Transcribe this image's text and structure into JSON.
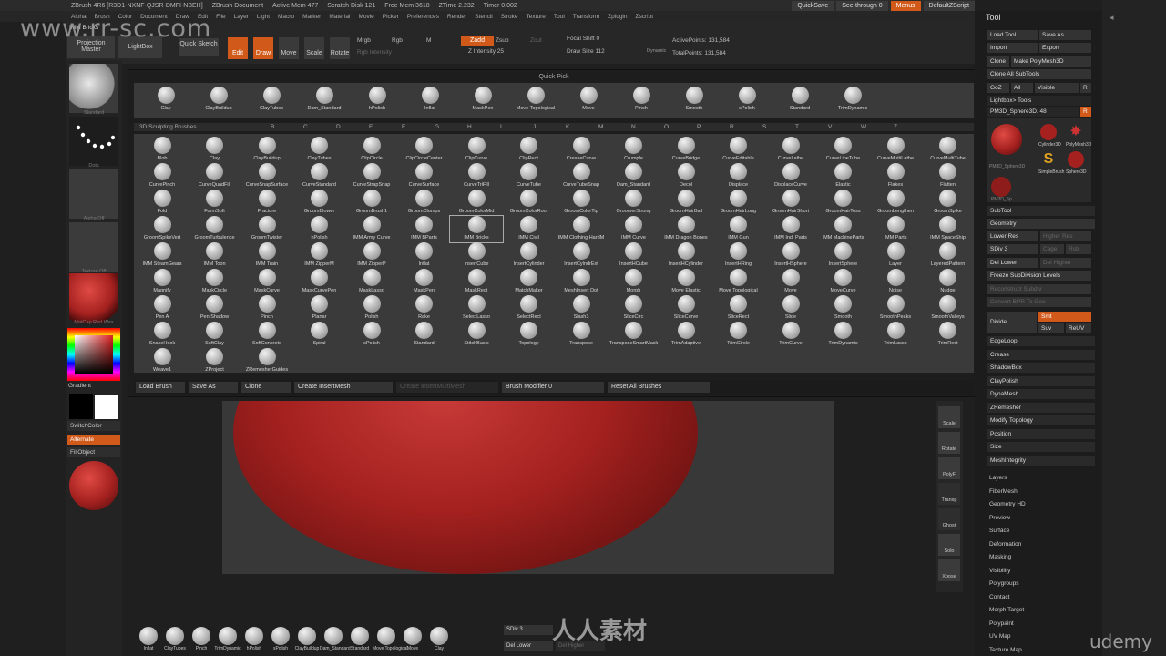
{
  "window": {
    "title": "ZBrush 4R6 [R3D1-NXNF-QJSR-DMFI-NBEH]",
    "document": "ZBrush Document",
    "active_mem": "Active Mem 477",
    "scratch_disk": "Scratch Disk 121",
    "free_mem": "Free Mem 3618",
    "ztime": "ZTime 2.232",
    "timer": "Timer 0.002",
    "quicksave": "QuickSave",
    "see_through": "See-through 0",
    "menus": "Menus",
    "default_zscript": "DefaultZScript"
  },
  "menu": [
    "Alpha",
    "Brush",
    "Color",
    "Document",
    "Draw",
    "Edit",
    "File",
    "Layer",
    "Light",
    "Macro",
    "Marker",
    "Material",
    "Movie",
    "Picker",
    "Preferences",
    "Render",
    "Stencil",
    "Stroke",
    "Texture",
    "Tool",
    "Transform",
    "Zplugin",
    "Zscript"
  ],
  "watermark_url": "www.rr-sc.com",
  "toolbar": {
    "imm_brush": "IMM Bricks",
    "projection_master": "Projection Master",
    "lightbox": "LightBox",
    "quick_sketch": "Quick Sketch",
    "edit": "Edit",
    "draw": "Draw",
    "move": "Move",
    "scale": "Scale",
    "rotate": "Rotate",
    "mrgb": "Mrgb",
    "rgb": "Rgb",
    "m": "M",
    "rgb_intensity": "Rgb Intensity",
    "zadd": "Zadd",
    "zsub": "Zsub",
    "zcut": "Zcut",
    "z_intensity": "Z Intensity 25",
    "focal_shift": "Focal Shift 0",
    "draw_size": "Draw Size 112",
    "dynamic": "Dynamic",
    "active_points": "ActivePoints: 131,584",
    "total_points": "TotalPoints: 131,584"
  },
  "popup": {
    "quick_pick_title": "Quick Pick",
    "section_title": "3D Sculpting Brushes",
    "letters": [
      "B",
      "C",
      "D",
      "E",
      "F",
      "G",
      "H",
      "I",
      "J",
      "K",
      "M",
      "N",
      "O",
      "P",
      "R",
      "S",
      "T",
      "V",
      "W",
      "Z"
    ],
    "quick_pick": [
      "Clay",
      "ClayBuildup",
      "ClayTubes",
      "Dam_Standard",
      "hPolish",
      "Inflat",
      "MaskPen",
      "Move Topological",
      "Move",
      "Pinch",
      "Smooth",
      "sPolish",
      "Standard",
      "TrimDynamic"
    ],
    "brushes": [
      "Blob",
      "Clay",
      "ClayBuildup",
      "ClayTubes",
      "ClipCircle",
      "ClipCircleCenter",
      "ClipCurve",
      "ClipRect",
      "CreaseCurve",
      "Crumple",
      "CurveBridge",
      "CurveEditable",
      "CurveLathe",
      "CurveLineTube",
      "CurveMultiLathe",
      "CurveMultiTube",
      "CurvePinch",
      "CurveQuadFill",
      "CurveSnapSurface",
      "CurveStandard",
      "CurveStrapSnap",
      "CurveSurface",
      "CurveTriFill",
      "CurveTube",
      "CurveTubeSnap",
      "Dam_Standard",
      "Decol",
      "Displace",
      "DisplaceCurve",
      "Elastic",
      "Flakes",
      "Flatten",
      "Fold",
      "FormSoft",
      "Fracture",
      "GroomBlower",
      "GroomBrush1",
      "GroomClumps",
      "GroomColorMid",
      "GroomColorRoot",
      "GroomColorTip",
      "GroomerStrong",
      "GroomHairBall",
      "GroomHairLong",
      "GroomHairShort",
      "GroomHairToss",
      "GroomLengthen",
      "GroomSpike",
      "GroomSpikeVert",
      "GroomTurbulence",
      "GroomTwister",
      "hPolish",
      "IMM Army Curve",
      "IMM BParts",
      "IMM Bricks",
      "IMM Civil",
      "IMM Clothing HardM",
      "IMM Curve",
      "IMM Dragon Bones",
      "IMM Gun",
      "IMM Ind. Parts",
      "IMM MachineParts",
      "IMM Parts",
      "IMM SpaceShip",
      "IMM SteamGears",
      "IMM Toon",
      "IMM Train",
      "IMM ZipperM",
      "IMM ZipperP",
      "Inflat",
      "InsertCube",
      "InsertCylinder",
      "InsertCylndrExt",
      "InsertHCube",
      "InsertHCylinder",
      "InsertHRing",
      "InsertHSphere",
      "InsertSphere",
      "Layer",
      "LayeredPattern",
      "Magnify",
      "MaskCircle",
      "MaskCurve",
      "MaskCurvePen",
      "MaskLasso",
      "MaskPen",
      "MaskRect",
      "MatchMaker",
      "MeshInsert Dot",
      "Morph",
      "Move Elastic",
      "Move Topological",
      "Move",
      "MoveCurve",
      "Noise",
      "Nudge",
      "Pen A",
      "Pen Shadow",
      "Pinch",
      "Planar",
      "Polish",
      "Rake",
      "SelectLasso",
      "SelectRect",
      "Slash3",
      "SliceCirc",
      "SliceCurve",
      "SliceRect",
      "Slide",
      "Smooth",
      "SmoothPeaks",
      "SmoothValleys",
      "SnakeHook",
      "SoftClay",
      "SoftConcrete",
      "Spiral",
      "sPolish",
      "Standard",
      "StitchBasic",
      "Topology",
      "Transpose",
      "TransposeSmartMask",
      "TrimAdaptive",
      "TrimCircle",
      "TrimCurve",
      "TrimDynamic",
      "TrimLasso",
      "TrimRect",
      "Weave1",
      "ZProject",
      "ZRemesherGuides"
    ],
    "footer": {
      "load_brush": "Load Brush",
      "save_as": "Save As",
      "clone": "Clone",
      "create_insertmesh": "Create InsertMesh",
      "create_insertmultimesh": "Create InsertMultiMesh",
      "brush_modifier": "Brush Modifier 0",
      "reset_all_brushes": "Reset All Brushes"
    }
  },
  "left_shelf": {
    "standard": "Standard",
    "dots": "Dots",
    "alpha_off": "Alpha Off",
    "texture_off": "Texture Off",
    "matcap": "MatCap Red Wax",
    "gradient": "Gradient",
    "switch_color": "SwitchColor",
    "alternate": "Alternate",
    "fill_object": "FillObject"
  },
  "right_bar": [
    "Scale",
    "Rotate",
    "PolyF",
    "Transp",
    "Ghost",
    "Solo",
    "Xpose"
  ],
  "tool_panel": {
    "title": "Tool",
    "load_tool": "Load Tool",
    "save_as": "Save As",
    "import": "Import",
    "export": "Export",
    "clone": "Clone",
    "make_polymesh": "Make PolyMesh3D",
    "clone_all": "Clone All SubTools",
    "goz": "GoZ",
    "all": "All",
    "visible": "Visible",
    "r": "R",
    "lightbox_tools": "Lightbox> Tools",
    "current_tool": "PM3D_Sphere3D. 48",
    "tools": [
      "PM3D_Sphere3D",
      "Cylinder3D",
      "PolyMesh3D",
      "SimpleBrush",
      "Sphere3D",
      "PM3D_Sp"
    ],
    "subtool": "SubTool",
    "geometry": "Geometry",
    "lower_res": "Lower Res",
    "higher_res": "Higher Res",
    "sdiv": "SDiv 3",
    "cage": "Cage",
    "rstr": "Rstr",
    "del_lower": "Del Lower",
    "del_higher": "Del Higher",
    "freeze_subdivision": "Freeze SubDivision Levels",
    "reconstruct_subdiv": "Reconstruct Subdiv",
    "convert_bpr": "Convert BPR To Geo",
    "divide": "Divide",
    "smt": "Smt",
    "suv": "Suv",
    "reuv": "ReUV",
    "geometry_items": [
      "EdgeLoop",
      "Crease",
      "ShadowBox",
      "ClayPolish",
      "DynaMesh",
      "ZRemesher",
      "Modify Topology",
      "Position",
      "Size",
      "MeshIntegrity"
    ],
    "sections": [
      "Layers",
      "FiberMesh",
      "Geometry HD",
      "Preview",
      "Surface",
      "Deformation",
      "Masking",
      "Visibility",
      "Polygroups",
      "Contact",
      "Morph Target",
      "Polypaint",
      "UV Map",
      "Texture Map"
    ]
  },
  "bottom_shelf": [
    "Inflat",
    "ClayTubes",
    "Pinch",
    "TrimDynamic",
    "hPolish",
    "sPolish",
    "ClayBuildup",
    "Dam_Standard",
    "Standard",
    "Move Topological",
    "Move",
    "Clay"
  ],
  "bottom_res": {
    "sdiv": "SDiv 3",
    "del_lower": "Del Lower",
    "del_higher": "Del Higher"
  },
  "brand": "udemy",
  "center_watermark": "人人素材",
  "colors": {
    "accent": "#d15a1a",
    "panel": "#1d1d1d",
    "material": "#a4211f"
  }
}
